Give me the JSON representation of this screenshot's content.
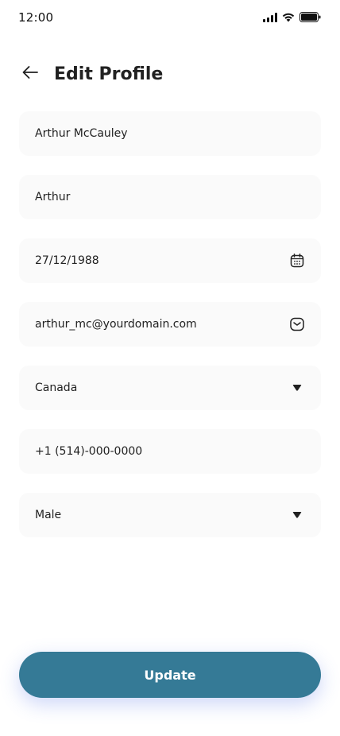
{
  "status_bar": {
    "time": "12:00"
  },
  "header": {
    "title": "Edit Profile"
  },
  "fields": {
    "full_name": "Arthur McCauley",
    "nickname": "Arthur",
    "birth_date": "27/12/1988",
    "email": "arthur_mc@yourdomain.com",
    "country": "Canada",
    "phone": "+1 (514)-000-0000",
    "gender": "Male"
  },
  "icons": {
    "back": "arrow-left-icon",
    "calendar": "calendar-icon",
    "email": "mail-icon",
    "dropdown": "caret-down-icon"
  },
  "actions": {
    "update_label": "Update"
  },
  "colors": {
    "primary": "#357a96",
    "field_bg": "#fafafa",
    "text": "#212121"
  }
}
